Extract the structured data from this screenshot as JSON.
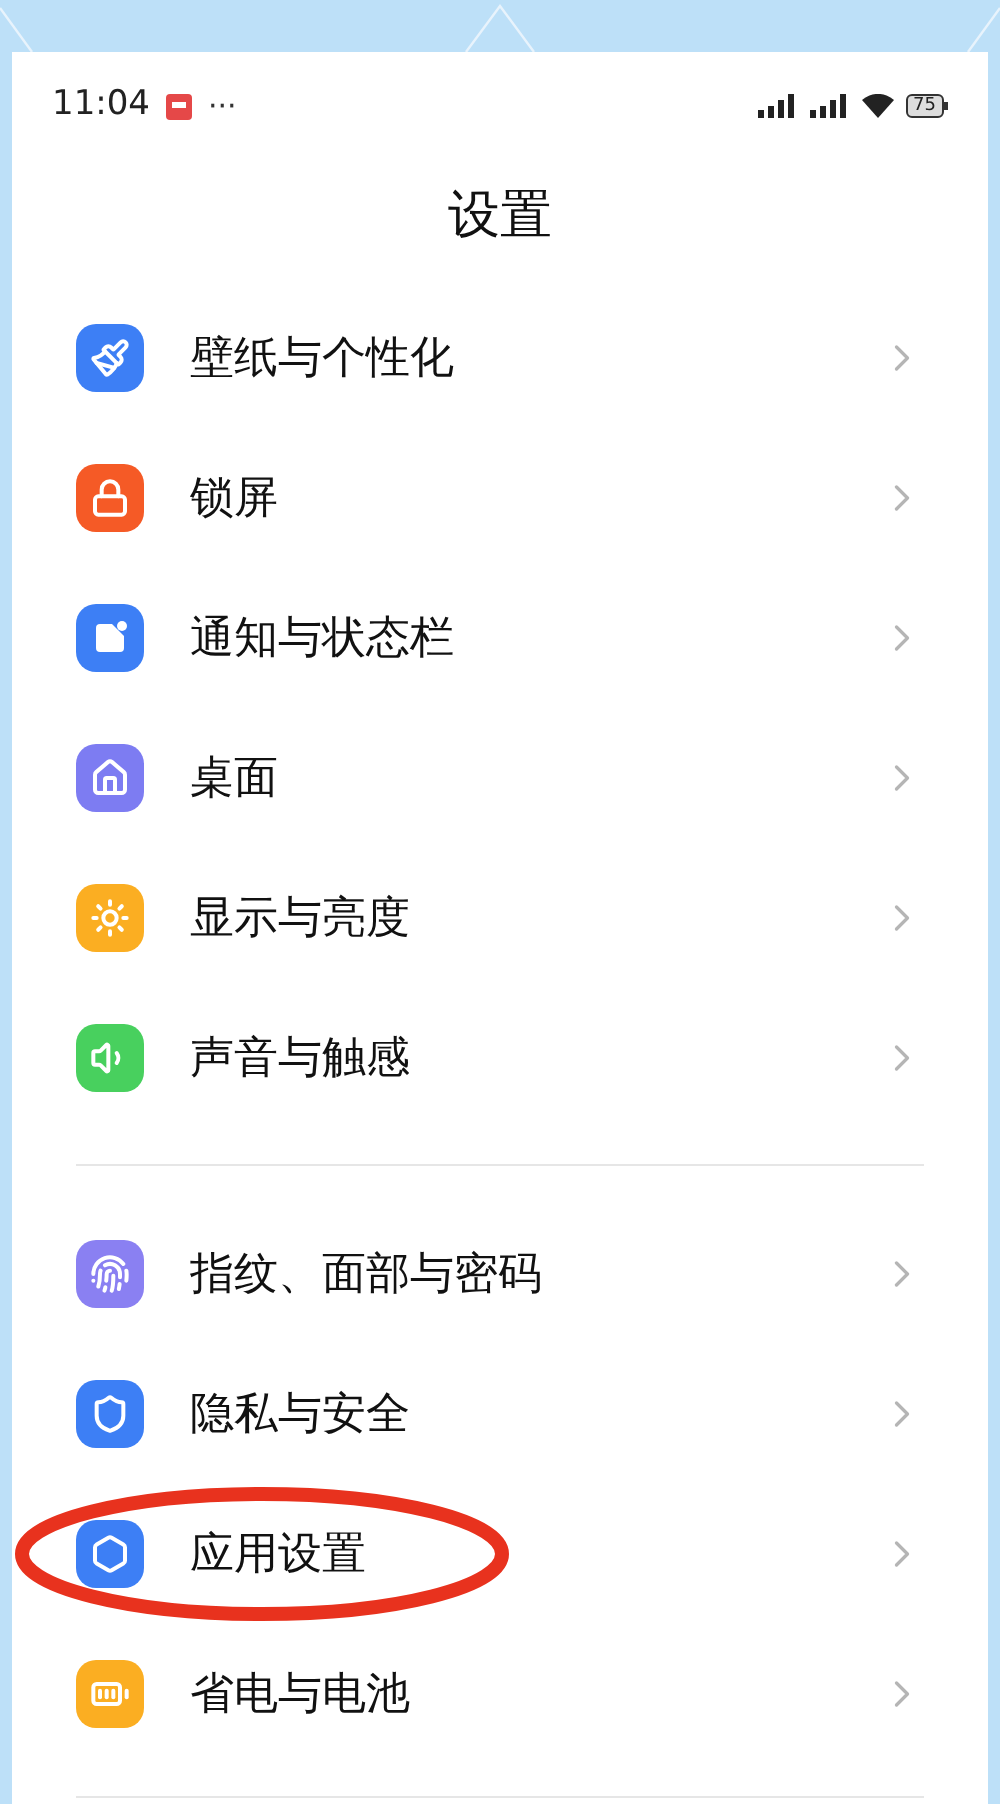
{
  "status_bar": {
    "time": "11:04",
    "more": "···",
    "battery": "75"
  },
  "title": "设置",
  "groups": [
    {
      "items": [
        {
          "label": "壁纸与个性化",
          "kind": "brush",
          "color": "#3d7ff5",
          "circled": false
        },
        {
          "label": "锁屏",
          "kind": "lock",
          "color": "#f55a26",
          "circled": false
        },
        {
          "label": "通知与状态栏",
          "kind": "notification",
          "color": "#3d7ff5",
          "circled": false
        },
        {
          "label": "桌面",
          "kind": "home",
          "color": "#7d7cf2",
          "circled": false
        },
        {
          "label": "显示与亮度",
          "kind": "sun",
          "color": "#fbae22",
          "circled": false
        },
        {
          "label": "声音与触感",
          "kind": "sound",
          "color": "#48d05e",
          "circled": false
        }
      ]
    },
    {
      "items": [
        {
          "label": "指纹、面部与密码",
          "kind": "fingerprint",
          "color": "#8a80f2",
          "circled": false
        },
        {
          "label": "隐私与安全",
          "kind": "privacy",
          "color": "#3d7ff5",
          "circled": false
        },
        {
          "label": "应用设置",
          "kind": "apps",
          "color": "#3d7ff5",
          "circled": true
        },
        {
          "label": "省电与电池",
          "kind": "battery",
          "color": "#fbae22",
          "circled": false
        }
      ]
    }
  ]
}
